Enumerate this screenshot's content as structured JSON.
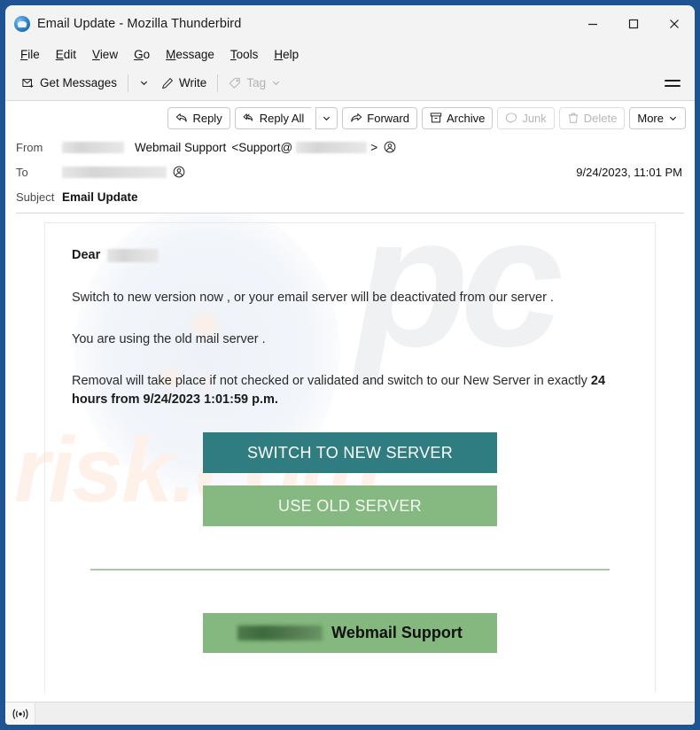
{
  "window": {
    "title": "Email Update - Mozilla Thunderbird",
    "logo_icon": "thunderbird-logo-icon",
    "minimize_label": "Minimize",
    "maximize_label": "Maximize",
    "close_label": "Close"
  },
  "menubar": {
    "items": [
      {
        "label": "File",
        "accel": "F",
        "rest": "ile"
      },
      {
        "label": "Edit",
        "accel": "E",
        "rest": "dit"
      },
      {
        "label": "View",
        "accel": "V",
        "rest": "iew"
      },
      {
        "label": "Go",
        "accel": "G",
        "rest": "o"
      },
      {
        "label": "Message",
        "accel": "M",
        "rest": "essage"
      },
      {
        "label": "Tools",
        "accel": "T",
        "rest": "ools"
      },
      {
        "label": "Help",
        "accel": "H",
        "rest": "elp"
      }
    ]
  },
  "maintoolbar": {
    "get_messages": "Get Messages",
    "write": "Write",
    "tag": "Tag",
    "app_menu_label": "Application Menu"
  },
  "msgtoolbar": {
    "reply": "Reply",
    "reply_all": "Reply All",
    "forward": "Forward",
    "archive": "Archive",
    "junk": "Junk",
    "delete": "Delete",
    "more": "More"
  },
  "headers": {
    "from_label": "From",
    "from_display_name": "Webmail Support",
    "from_address_prefix": "<Support@",
    "from_address_suffix": ">",
    "to_label": "To",
    "subject_label": "Subject",
    "subject_value": "Email Update",
    "date": "9/24/2023, 11:01 PM"
  },
  "body": {
    "greeting": "Dear",
    "paragraph_1": "Switch to new version now  , or your email server will be deactivated from our server .",
    "paragraph_2": "You  are using the old  mail server .",
    "paragraph_3_text": "Removal will take place if not checked or validated and switch to our New Server in exactly ",
    "paragraph_3_bold": "24 hours from 9/24/2023 1:01:59 p.m.",
    "cta_primary": "SWITCH TO NEW SERVER",
    "cta_secondary": "USE OLD SERVER",
    "signature_name": "Webmail Support",
    "watermark_top": "pc",
    "watermark_bottom": "risk.com"
  },
  "statusbar": {
    "connection_icon": "online-status-icon"
  },
  "colors": {
    "window_chrome": "#f3f3f3",
    "desktop_background": "#1f5492",
    "cta_primary_bg": "#2f7d80",
    "cta_secondary_bg": "#86b981",
    "signature_bg": "#84b87e",
    "divider": "#a7c9a4",
    "watermark_grey": "#f0f1f3",
    "watermark_peach": "#fdf1e9"
  }
}
